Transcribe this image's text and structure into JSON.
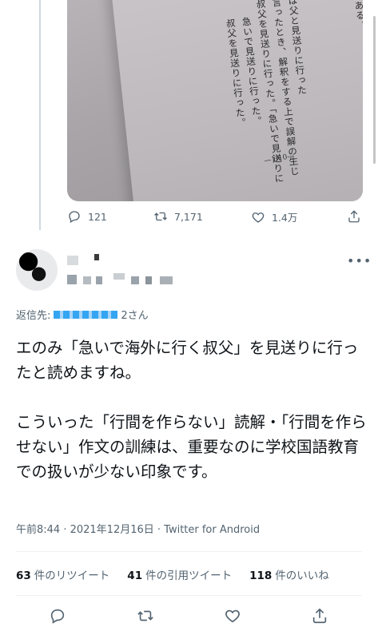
{
  "previous_tweet": {
    "photo_text": {
      "columns": [
        "す。",
        "である。",
        "は父と見送りに行った",
        "言ったとき、解釈をする上で誤解の生じ",
        "叔父を見送りに行った。「急いで見送りに",
        "急いで見送りに行った。",
        "叔父を見送りに行った。"
      ],
      "page_number": "—1/10—"
    },
    "stats": {
      "replies": "121",
      "retweets": "7,171",
      "likes": "1.4万"
    }
  },
  "tweet": {
    "reply_to_label": "返信先:",
    "reply_to_suffix": "2さん",
    "body": "エのみ「急いで海外に行く叔父」を見送りに行ったと読めますね。\n\nこういった「行間を作らない」読解・「行間を作らせない」作文の訓練は、重要なのに学校国語教育での扱いが少ない印象です。",
    "meta": "午前8:44 · 2021年12月16日 · Twitter for Android",
    "retweets_count": "63",
    "retweets_label": "件のリツイート",
    "quotes_count": "41",
    "quotes_label": "件の引用ツイート",
    "likes_count": "118",
    "likes_label": "件のいいね"
  },
  "icons": {
    "reply": "reply-icon",
    "retweet": "retweet-icon",
    "like": "heart-icon",
    "share": "share-icon",
    "more": "more-icon"
  },
  "colors": {
    "text": "#0f1419",
    "secondary": "#536471",
    "accent": "#1d9bf0"
  }
}
